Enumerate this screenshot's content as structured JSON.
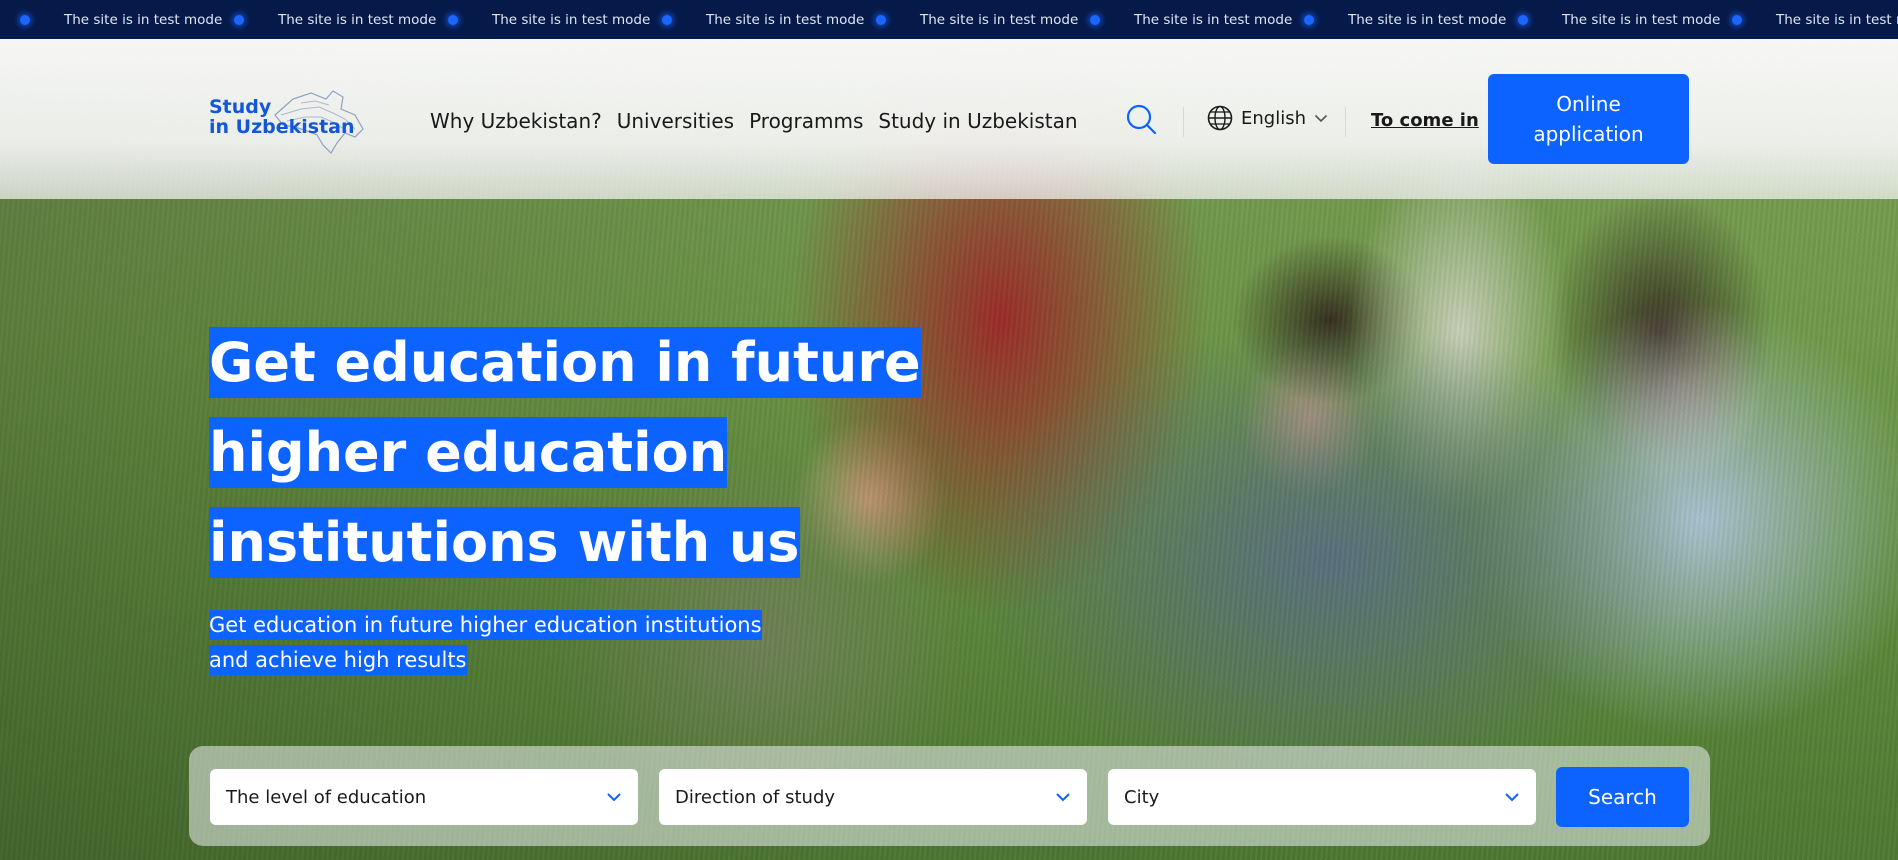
{
  "ticker": {
    "message": "The site is in test mode",
    "items": [
      "The site is in test mode",
      "The site is in test mode",
      "The site is in test mode",
      "The site is in test mode",
      "The site is in test mode",
      "The site is in test mode",
      "The site is in test mode",
      "The site is in test mode",
      "The site is in test mode"
    ],
    "dot_color": "#1a66ff",
    "background": "#061a4a"
  },
  "header": {
    "logo": {
      "line1": "Study",
      "line2": "in Uzbekistan"
    },
    "nav": [
      "Why Uzbekistan?",
      "Universities",
      "Programms",
      "Study in Uzbekistan"
    ],
    "search_icon": "search-icon",
    "language": {
      "icon": "globe-icon",
      "label": "English"
    },
    "login_label": "To come in",
    "apply_label": "Online application"
  },
  "hero": {
    "headline_lines": [
      "Get education in future",
      "higher education",
      "institutions with us"
    ],
    "subline_lines": [
      "Get education in future higher education institutions",
      "and achieve high results"
    ]
  },
  "filters": {
    "level": "The level of education",
    "direction": "Direction of study",
    "city": "City",
    "search_label": "Search"
  },
  "colors": {
    "accent": "#0c63ff",
    "logo": "#1157d6",
    "ticker_bg": "#061a4a"
  }
}
